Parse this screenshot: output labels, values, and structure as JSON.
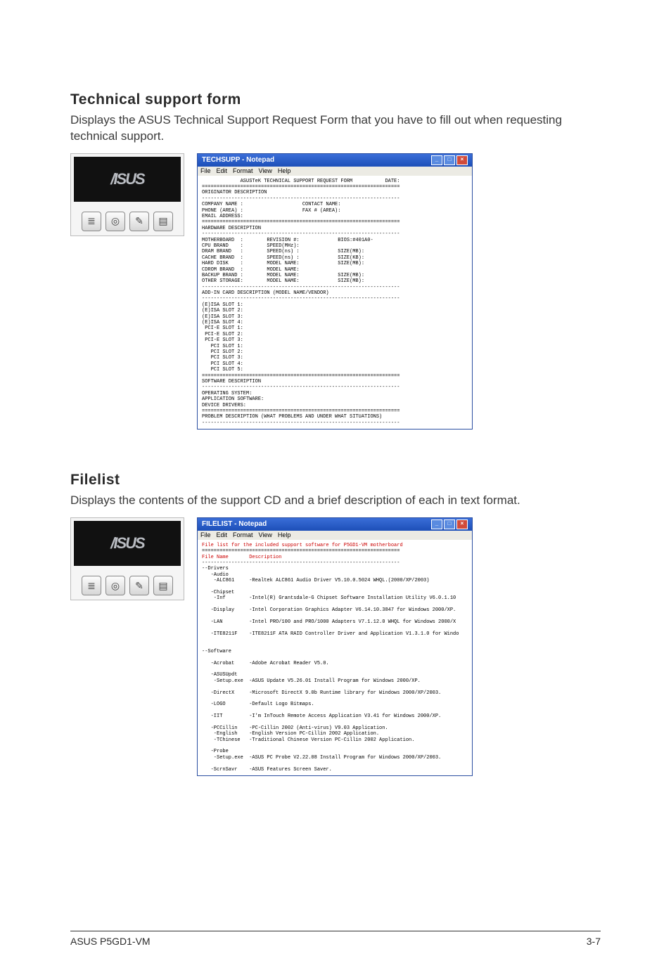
{
  "sections": [
    {
      "title": "Technical support form",
      "desc": "Displays the ASUS Technical Support Request Form that you have to fill out when requesting technical support."
    },
    {
      "title": "Filelist",
      "desc": "Displays the contents of the support CD and a brief description of each in text format."
    }
  ],
  "thumb_icons": [
    "list-icon",
    "disc-icon",
    "wrench-icon",
    "page-icon"
  ],
  "notepad1": {
    "title": "TECHSUPP - Notepad",
    "menu": [
      "File",
      "Edit",
      "Format",
      "View",
      "Help"
    ],
    "body_lines": [
      "             ASUSTeK TECHNICAL SUPPORT REQUEST FORM           DATE:",
      "===================================================================",
      "ORIGINATOR DESCRIPTION",
      "-------------------------------------------------------------------",
      "COMPANY NAME :                    CONTACT NAME:",
      "PHONE (AREA) :                    FAX # (AREA):",
      "EMAIL ADDRESS:",
      "===================================================================",
      "HARDWARE DESCRIPTION",
      "-------------------------------------------------------------------",
      "MOTHERBOARD  :        REVISION #:             BIOS:#401A0-",
      "CPU BRAND    :        SPEED(MHz):",
      "DRAM BRAND   :        SPEED(ns) :             SIZE(MB):",
      "CACHE BRAND  :        SPEED(ns) :             SIZE(KB):",
      "HARD DISK    :        MODEL NAME:             SIZE(MB):",
      "CDROM BRAND  :        MODEL NAME:",
      "BACKUP BRAND :        MODEL NAME:             SIZE(MB):",
      "OTHER STORAGE:        MODEL NAME:             SIZE(MB):",
      "-------------------------------------------------------------------",
      "ADD-IN CARD DESCRIPTION (MODEL NAME/VENDOR)",
      "-------------------------------------------------------------------",
      "(E)ISA SLOT 1:",
      "(E)ISA SLOT 2:",
      "(E)ISA SLOT 3:",
      "(E)ISA SLOT 4:",
      " PCI-E SLOT 1:",
      " PCI-E SLOT 2:",
      " PCI-E SLOT 3:",
      "   PCI SLOT 1:",
      "   PCI SLOT 2:",
      "   PCI SLOT 3:",
      "   PCI SLOT 4:",
      "   PCI SLOT 5:",
      "===================================================================",
      "SOFTWARE DESCRIPTION",
      "-------------------------------------------------------------------",
      "OPERATING SYSTEM:",
      "APPLICATION SOFTWARE:",
      "DEVICE DRIVERS:",
      "===================================================================",
      "PROBLEM DESCRIPTION (WHAT PROBLEMS AND UNDER WHAT SITUATIONS)",
      "-------------------------------------------------------------------"
    ]
  },
  "notepad2": {
    "title": "FILELIST - Notepad",
    "menu": [
      "File",
      "Edit",
      "Format",
      "View",
      "Help"
    ],
    "header_line": "File list for the included support software for P5GD1-VM motherboard",
    "col1": "File Name",
    "col2": "Description",
    "rows": [
      [
        "--Drivers",
        ""
      ],
      [
        "   -Audio",
        ""
      ],
      [
        "    -ALC861",
        "-Realtek ALC861 Audio Driver V5.10.0.5024 WHQL.(2000/XP/2003)"
      ],
      [
        "",
        ""
      ],
      [
        "   -Chipset",
        ""
      ],
      [
        "    -Inf",
        "-Intel(R) Grantsdale-G Chipset Software Installation Utility V6.0.1.10"
      ],
      [
        "",
        ""
      ],
      [
        "   -Display",
        "-Intel Corporation Graphics Adapter V6.14.10.3847 for Windows 2000/XP."
      ],
      [
        "",
        ""
      ],
      [
        "   -LAN",
        "-Intel PRO/100 and PRO/1000 Adapters V7.1.12.0 WHQL for Windows 2000/X"
      ],
      [
        "",
        ""
      ],
      [
        "   -ITE8211F",
        "-ITE8211F ATA RAID Controller Driver and Application V1.3.1.0 for Windo"
      ],
      [
        "",
        ""
      ],
      [
        "",
        ""
      ],
      [
        "--Software",
        ""
      ],
      [
        "",
        ""
      ],
      [
        "   -Acrobat",
        "-Adobe Acrobat Reader V5.0."
      ],
      [
        "",
        ""
      ],
      [
        "   -ASUSUpdt",
        ""
      ],
      [
        "    -Setup.exe",
        "-ASUS Update V5.26.01 Install Program for Windows 2000/XP."
      ],
      [
        "",
        ""
      ],
      [
        "   -DirectX",
        "-Microsoft DirectX 9.0b Runtime library for Windows 2000/XP/2003."
      ],
      [
        "",
        ""
      ],
      [
        "   -LOGO",
        "-Default Logo Bitmaps."
      ],
      [
        "",
        ""
      ],
      [
        "   -IIT",
        "-I'm InTouch Remote Access Application V3.41 for Windows 2000/XP."
      ],
      [
        "",
        ""
      ],
      [
        "   -PCCillin",
        "-PC-Cillin 2002 (Anti-virus) V9.03 Application."
      ],
      [
        "    -English",
        "-English Version PC-Cillin 2002 Application."
      ],
      [
        "    -TChinese",
        "-Traditional Chinese Version PC-Cillin 2002 Application."
      ],
      [
        "",
        ""
      ],
      [
        "   -Probe",
        ""
      ],
      [
        "    -Setup.exe",
        "-ASUS PC Probe V2.22.08 Install Program for Windows 2000/XP/2003."
      ],
      [
        "",
        ""
      ],
      [
        "   -ScrnSavr",
        "-ASUS Features Screen Saver."
      ]
    ]
  },
  "footer_left": "ASUS P5GD1-VM",
  "footer_right": "3-7"
}
